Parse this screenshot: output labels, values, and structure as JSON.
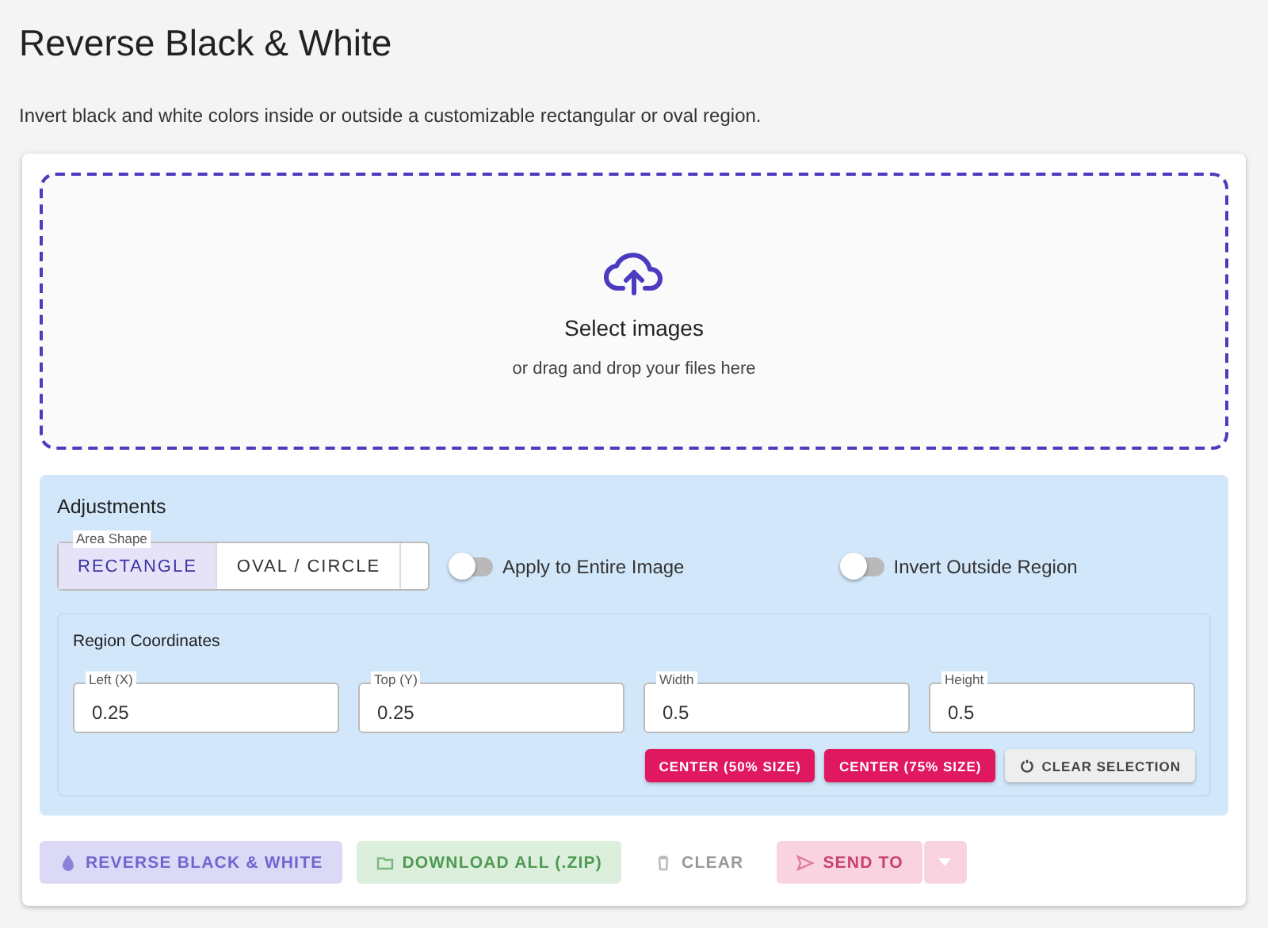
{
  "page": {
    "title": "Reverse Black & White",
    "description": "Invert black and white colors inside or outside a customizable rectangular or oval region."
  },
  "dropzone": {
    "title": "Select images",
    "hint": "or drag and drop your files here"
  },
  "adjustments": {
    "title": "Adjustments",
    "area_shape": {
      "label": "Area Shape",
      "options": [
        {
          "label": "RECTANGLE",
          "selected": true
        },
        {
          "label": "OVAL / CIRCLE",
          "selected": false
        }
      ]
    },
    "toggles": [
      {
        "label": "Apply to Entire Image",
        "on": false
      },
      {
        "label": "Invert Outside Region",
        "on": false
      }
    ],
    "region": {
      "title": "Region Coordinates",
      "fields": [
        {
          "label": "Left (X)",
          "value": "0.25"
        },
        {
          "label": "Top (Y)",
          "value": "0.25"
        },
        {
          "label": "Width",
          "value": "0.5"
        },
        {
          "label": "Height",
          "value": "0.5"
        }
      ],
      "buttons": [
        {
          "label": "CENTER (50% SIZE)",
          "kind": "primary"
        },
        {
          "label": "CENTER (75% SIZE)",
          "kind": "primary"
        },
        {
          "label": "CLEAR SELECTION",
          "kind": "reset"
        }
      ]
    }
  },
  "actions": [
    {
      "label": "REVERSE BLACK & WHITE",
      "kind": "reverse",
      "disabled": true
    },
    {
      "label": "DOWNLOAD ALL (.ZIP)",
      "kind": "download",
      "disabled": true
    },
    {
      "label": "CLEAR",
      "kind": "clear",
      "disabled": true
    },
    {
      "label": "SEND TO",
      "kind": "send",
      "disabled": true
    }
  ]
}
